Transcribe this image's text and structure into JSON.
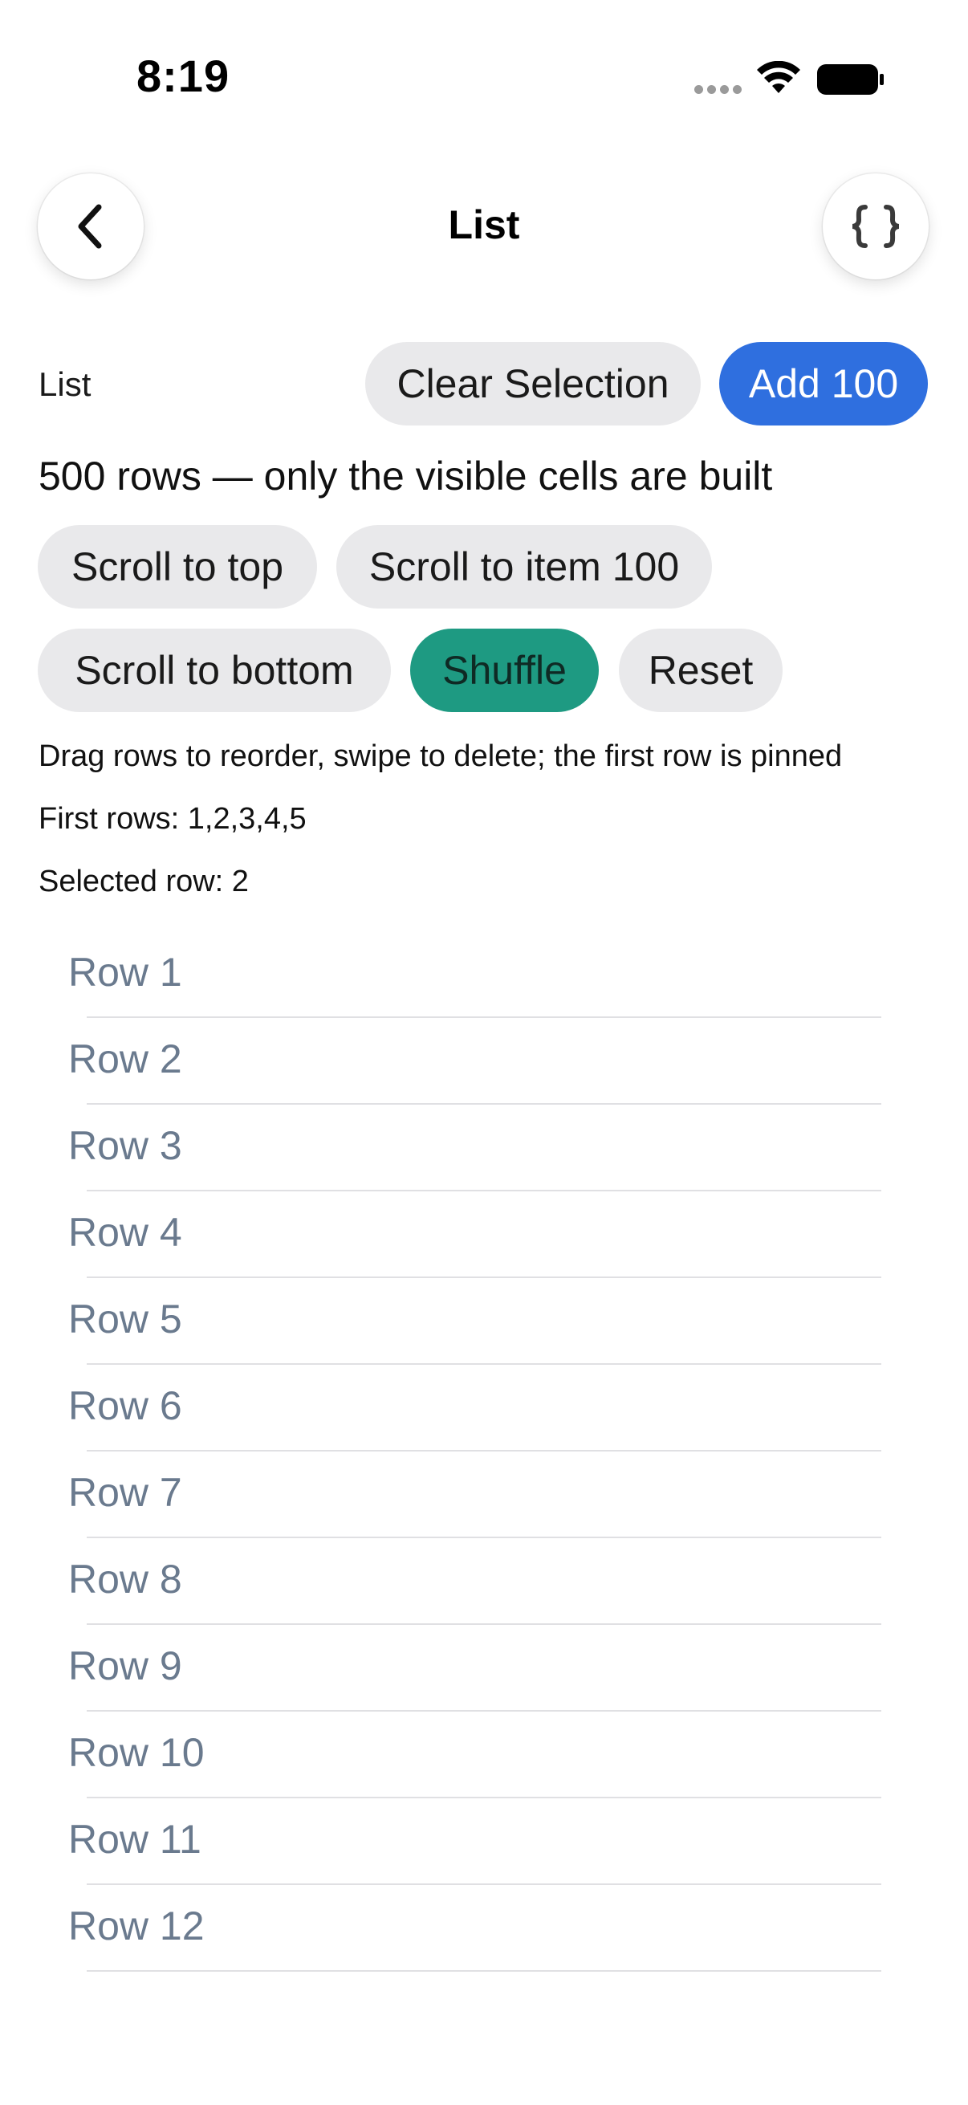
{
  "status_bar": {
    "time": "8:19"
  },
  "nav": {
    "title": "List",
    "back_icon": "chevron-left-icon",
    "code_icon": "curly-braces-icon"
  },
  "controls": {
    "section_label": "List",
    "clear_selection": "Clear Selection",
    "add_100": "Add 100",
    "summary": "500 rows — only the visible cells are built",
    "scroll_top": "Scroll to top",
    "scroll_item_100": "Scroll to item 100",
    "scroll_bottom": "Scroll to bottom",
    "shuffle": "Shuffle",
    "reset": "Reset",
    "hint": "Drag rows to reorder, swipe to delete; the first row is pinned",
    "first_rows": "First rows: 1,2,3,4,5",
    "selected_row": "Selected row: 2"
  },
  "colors": {
    "primary": "#2f6fdf",
    "accent": "#1e9a82",
    "pill_bg": "#e9e9eb",
    "row_text": "#6a7a8e"
  },
  "rows": [
    "Row 1",
    "Row 2",
    "Row 3",
    "Row 4",
    "Row 5",
    "Row 6",
    "Row 7",
    "Row 8",
    "Row 9",
    "Row 10",
    "Row 11",
    "Row 12"
  ]
}
